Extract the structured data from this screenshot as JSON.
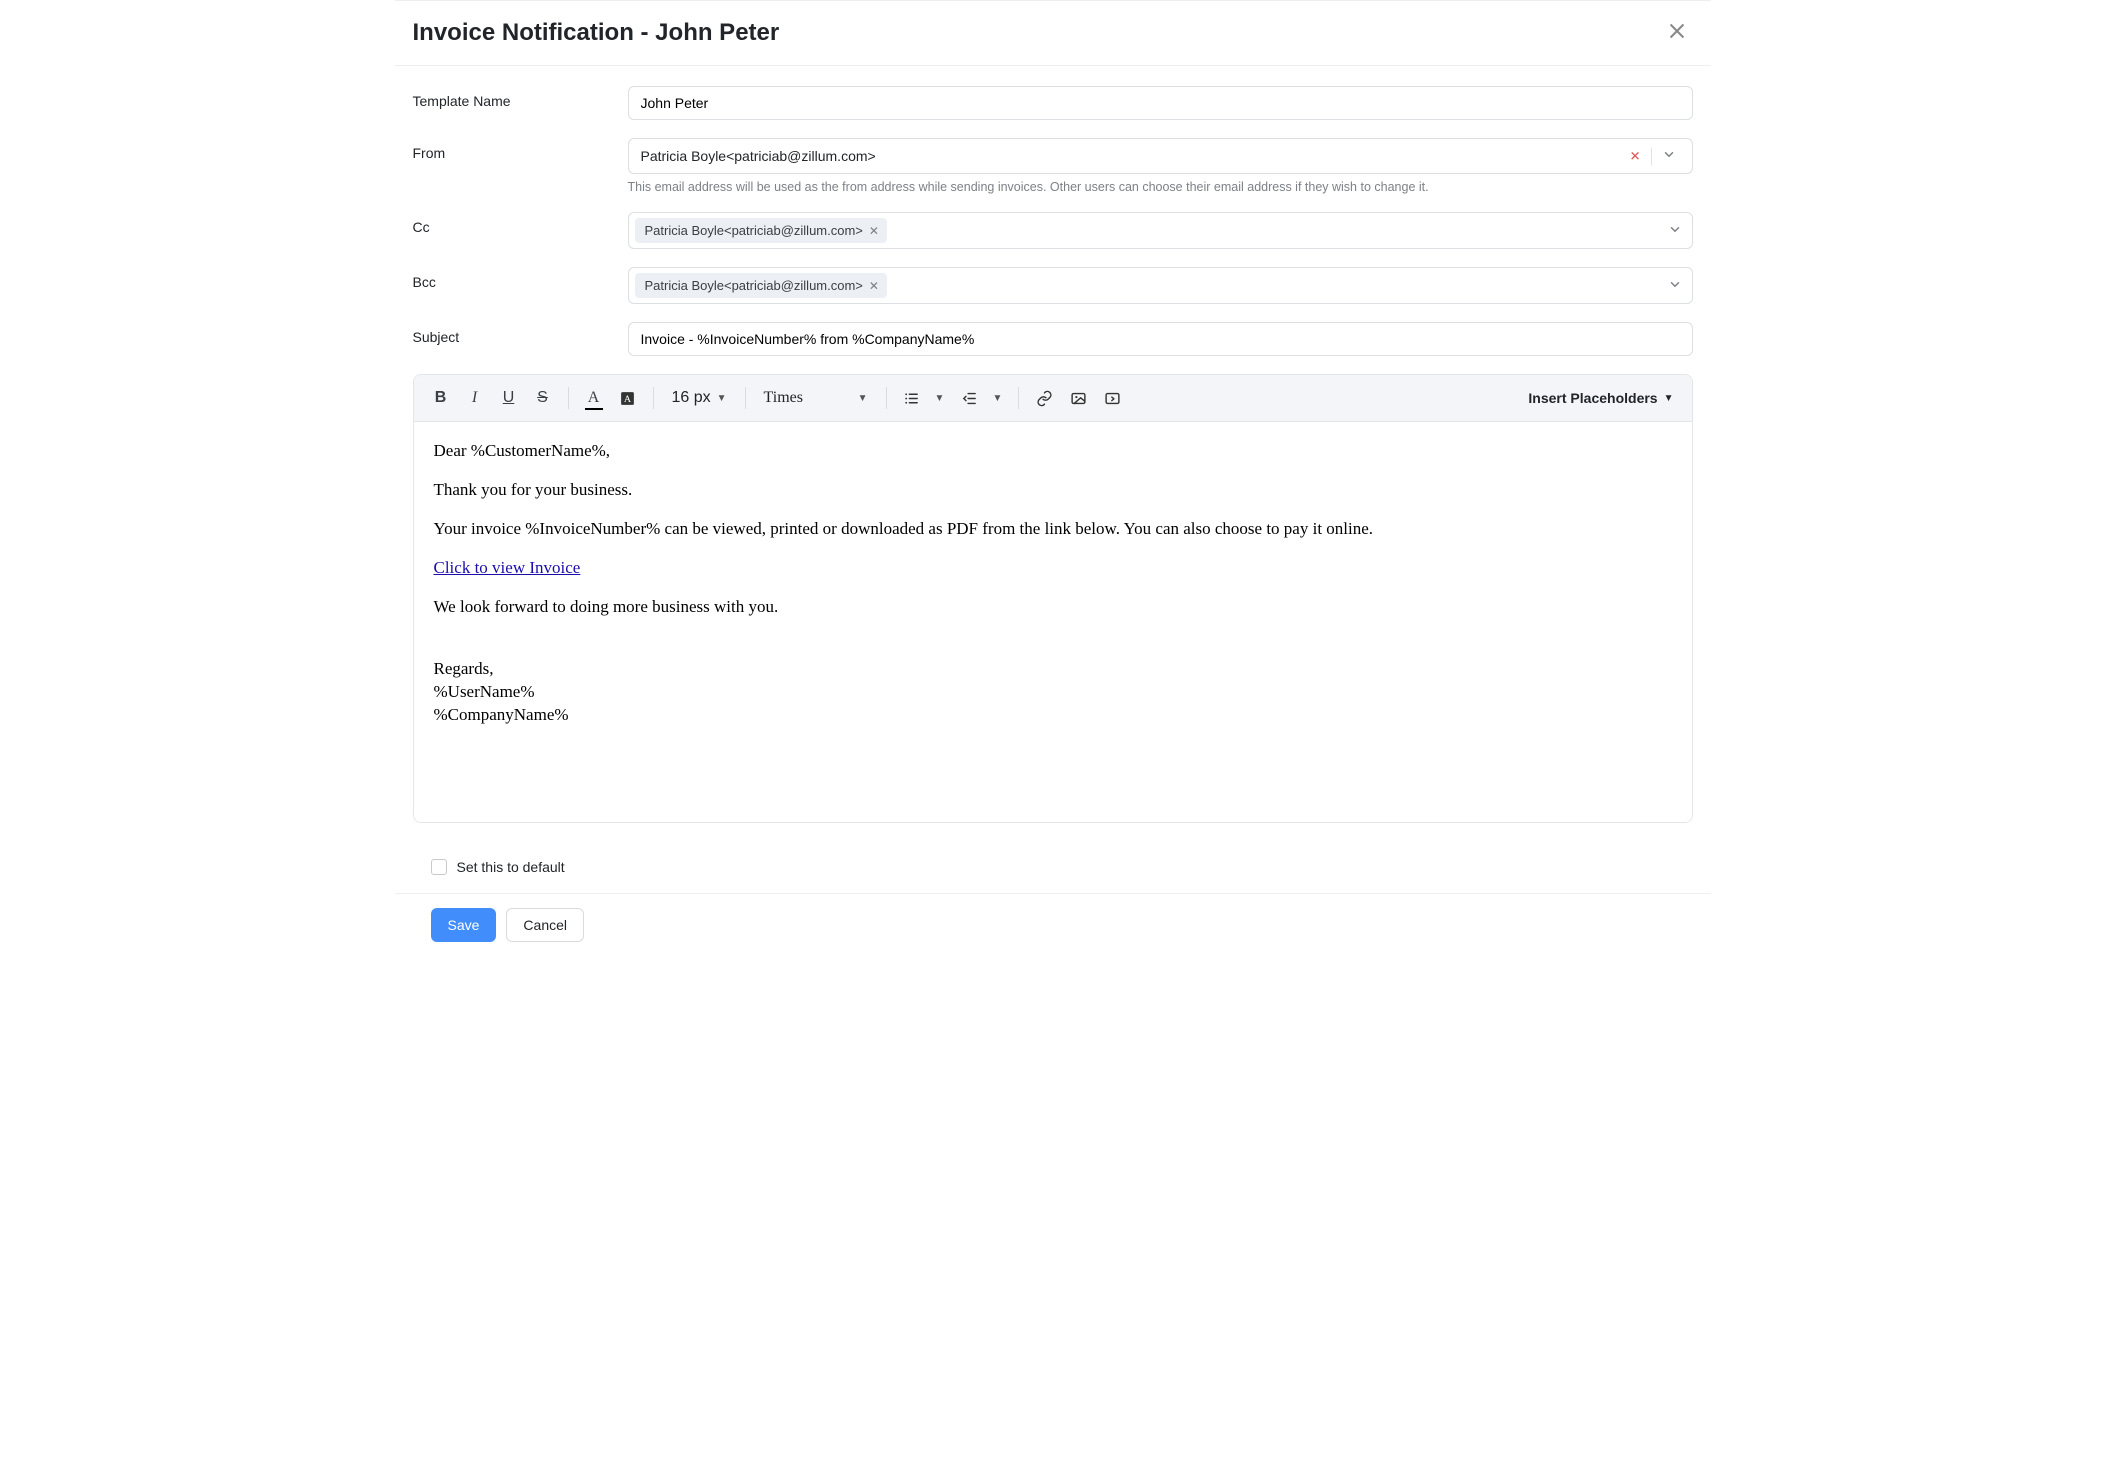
{
  "header": {
    "title": "Invoice Notification - John Peter"
  },
  "fields": {
    "templateName": {
      "label": "Template Name",
      "value": "John Peter"
    },
    "from": {
      "label": "From",
      "value": "Patricia Boyle<patriciab@zillum.com>",
      "helper": "This email address will be used as the from address while sending invoices. Other users can choose their email address if they wish to change it."
    },
    "cc": {
      "label": "Cc",
      "chip": "Patricia Boyle<patriciab@zillum.com>"
    },
    "bcc": {
      "label": "Bcc",
      "chip": "Patricia Boyle<patriciab@zillum.com>"
    },
    "subject": {
      "label": "Subject",
      "value": "Invoice - %InvoiceNumber% from %CompanyName%"
    }
  },
  "toolbar": {
    "fontSize": "16 px",
    "fontFamily": "Times",
    "insertPlaceholders": "Insert Placeholders"
  },
  "editor": {
    "greeting": "Dear %CustomerName%,",
    "line1": "Thank you for your business.",
    "line2": "Your invoice %InvoiceNumber% can be viewed, printed or downloaded as PDF from the link below. You can also choose to pay it online.",
    "linkText": "Click to view Invoice",
    "line3": "We look forward to doing more business with you.",
    "sig1": "Regards,",
    "sig2": "%UserName%",
    "sig3": "%CompanyName%"
  },
  "footer": {
    "defaultLabel": "Set this to default",
    "save": "Save",
    "cancel": "Cancel"
  }
}
